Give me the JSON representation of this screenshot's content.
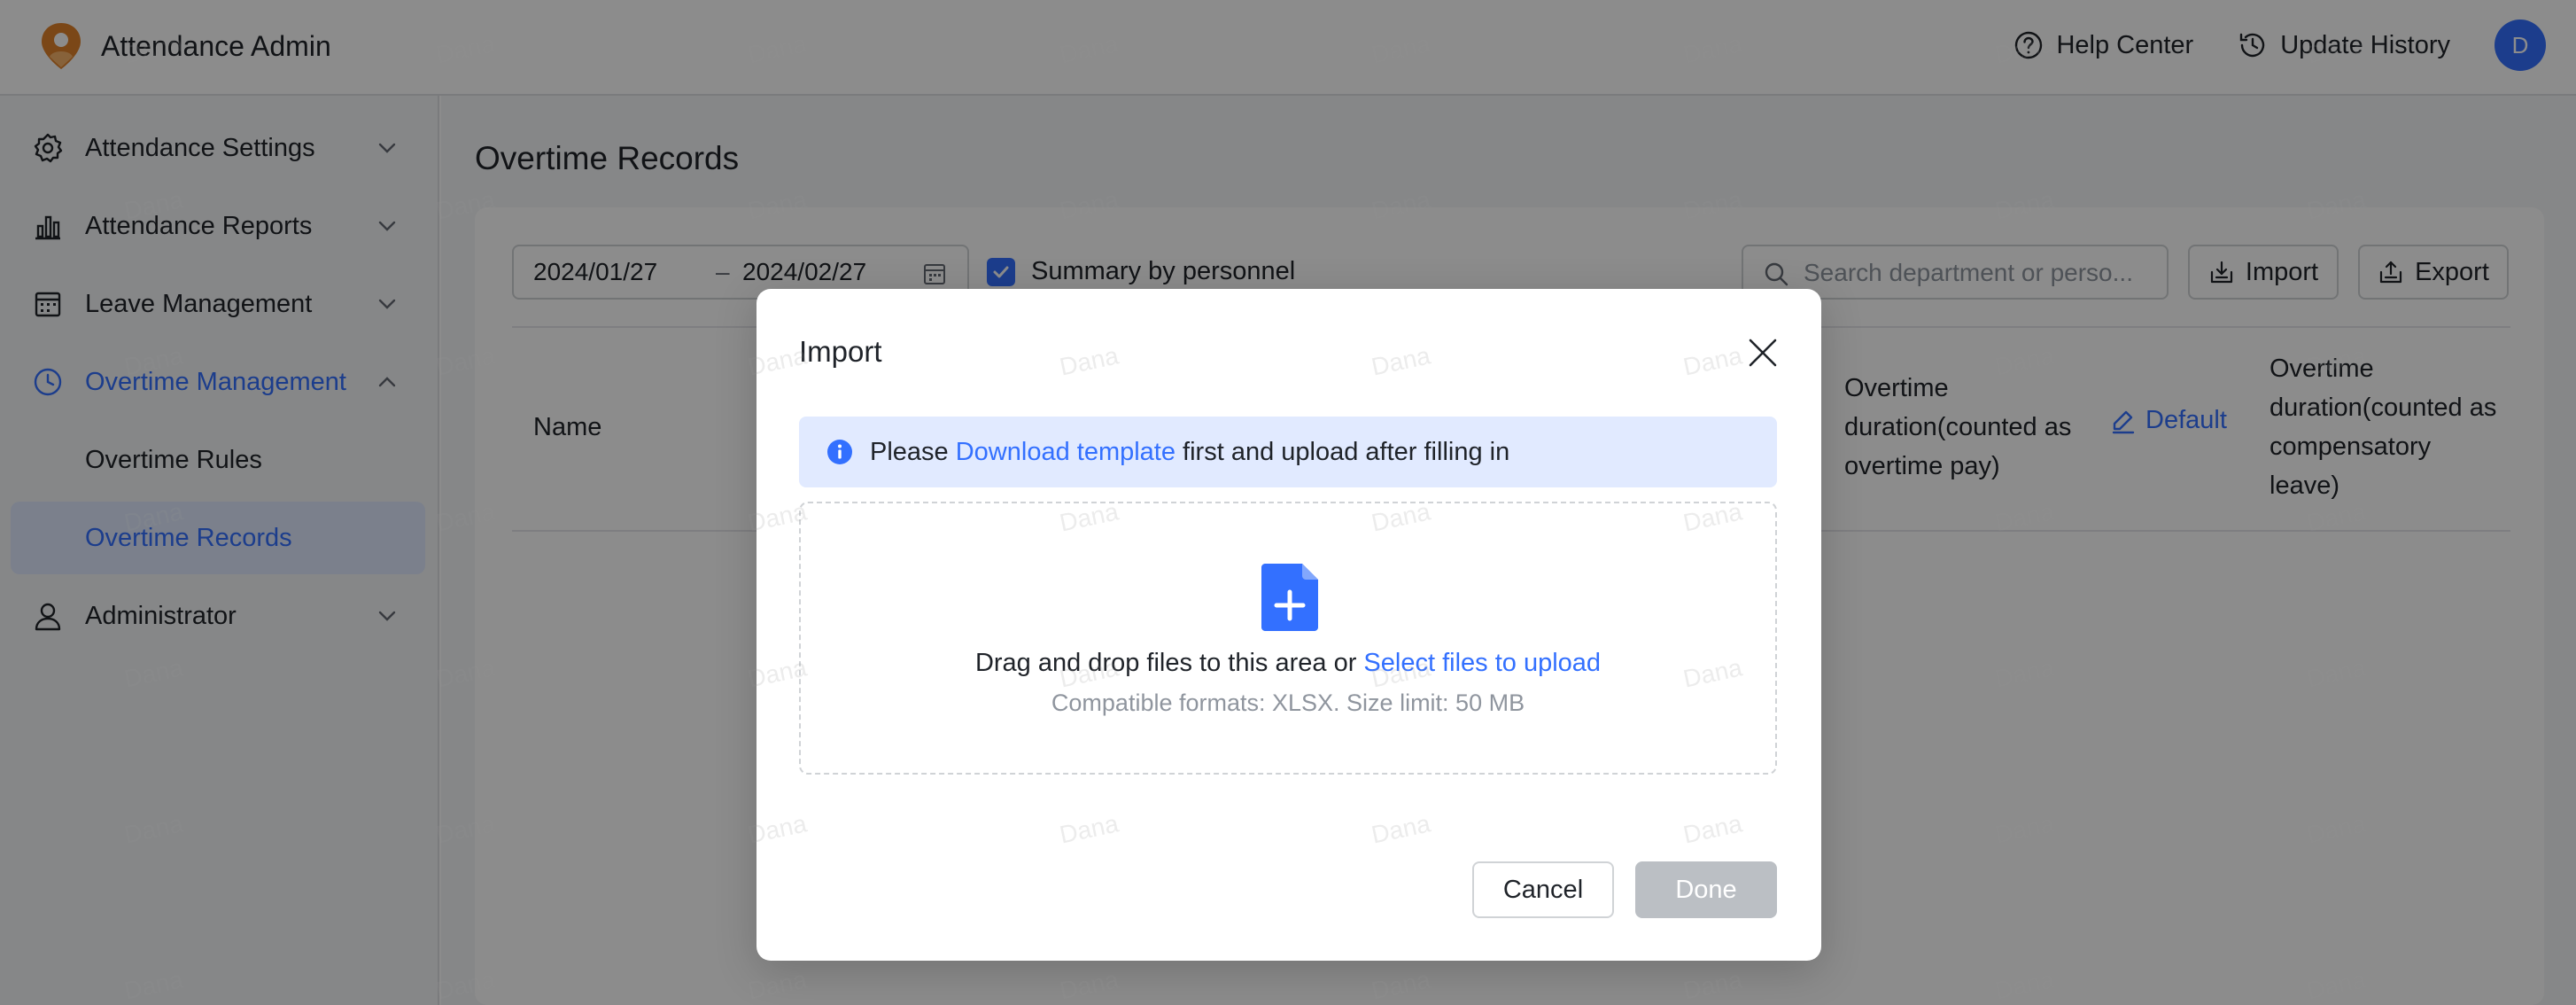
{
  "app": {
    "title": "Attendance Admin",
    "brand_color": "#3370ff",
    "logo_color": "#e0822b"
  },
  "header": {
    "help_label": "Help Center",
    "history_label": "Update History",
    "avatar_initial": "D"
  },
  "sidebar": {
    "items": [
      {
        "label": "Attendance Settings",
        "icon": "gear-icon",
        "expanded": false
      },
      {
        "label": "Attendance Reports",
        "icon": "bar-chart-icon",
        "expanded": false
      },
      {
        "label": "Leave Management",
        "icon": "calendar-grid-icon",
        "expanded": false
      },
      {
        "label": "Overtime Management",
        "icon": "clock-icon",
        "expanded": true,
        "active": true
      },
      {
        "label": "Administrator",
        "icon": "user-icon",
        "expanded": false
      }
    ],
    "subitems": [
      {
        "label": "Overtime Rules",
        "selected": false
      },
      {
        "label": "Overtime Records",
        "selected": true
      }
    ]
  },
  "main": {
    "page_title": "Overtime Records",
    "date_start": "2024/01/27",
    "date_sep": "–",
    "date_end": "2024/02/27",
    "summary_label": "Summary by personnel",
    "summary_checked": true,
    "search_placeholder": "Search department or perso...",
    "import_label": "Import",
    "export_label": "Export",
    "columns": {
      "name": "Name",
      "ot_pay": [
        "Overtime",
        "duration(counted as",
        "overtime pay)"
      ],
      "default_label": "Default",
      "ot_comp": [
        "Overtime",
        "duration(counted as",
        "compensatory",
        "leave)"
      ]
    }
  },
  "watermark": "Dana",
  "modal": {
    "title": "Import",
    "banner_prefix": "Please ",
    "banner_link": "Download template",
    "banner_suffix": " first and upload after filling in",
    "drop_text": "Drag and drop files to this area or ",
    "drop_link": "Select files to upload",
    "formats_text": "Compatible formats: XLSX. Size limit: 50 MB",
    "cancel_label": "Cancel",
    "done_label": "Done"
  }
}
